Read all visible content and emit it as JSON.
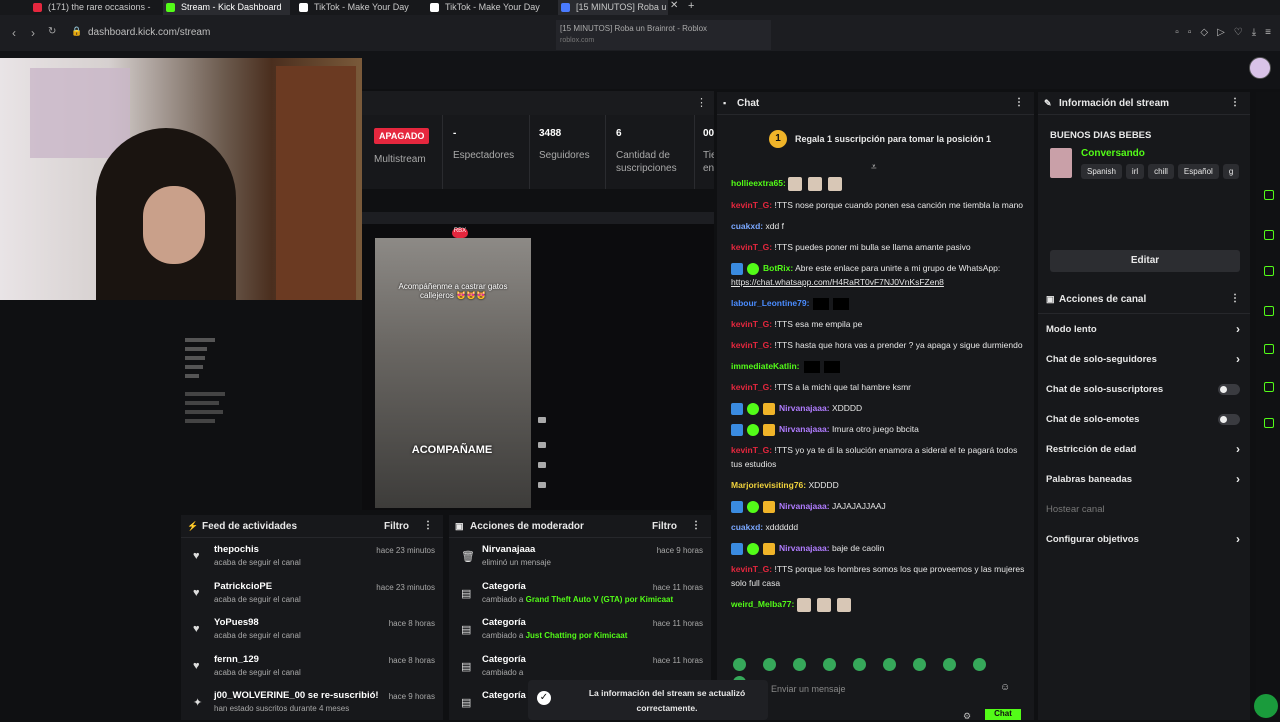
{
  "browser": {
    "tabs": [
      {
        "label": "(171) the rare occasions -",
        "color": "#e5273e"
      },
      {
        "label": "Stream - Kick Dashboard",
        "color": "#53fc18"
      },
      {
        "label": "TikTok - Make Your Day",
        "color": "#ffffff"
      },
      {
        "label": "TikTok - Make Your Day",
        "color": "#ffffff"
      },
      {
        "label": "[15 MINUTOS] Roba u",
        "color": "#4a7bff"
      }
    ],
    "url": "dashboard.kick.com/stream",
    "tooltip_title": "[15 MINUTOS] Roba un Brainrot - Roblox",
    "tooltip_domain": "roblox.com"
  },
  "stats": {
    "status": "APAGADO",
    "multistream": "Multistream",
    "viewers_value": "-",
    "viewers_label": "Espectadores",
    "followers_value": "3488",
    "followers_label": "Seguidores",
    "subs_value": "6",
    "subs_label": "Cantidad de suscripciones",
    "extra_value": "00",
    "extra_label": "Tie en"
  },
  "preview": {
    "caption_top": "Acompáñenme a castrar gatos callejeros 😻😻😻",
    "caption_bottom": "ACOMPAÑAME",
    "rbx": "RBX"
  },
  "activity": {
    "title": "Feed de actividades",
    "filter": "Filtro",
    "items": [
      {
        "name": "thepochis",
        "sub": "acaba de seguir el canal",
        "time": "hace 23 minutos"
      },
      {
        "name": "PatrickcioPE",
        "sub": "acaba de seguir el canal",
        "time": "hace 23 minutos"
      },
      {
        "name": "YoPues98",
        "sub": "acaba de seguir el canal",
        "time": "hace 8 horas"
      },
      {
        "name": "fernn_129",
        "sub": "acaba de seguir el canal",
        "time": "hace 8 horas"
      },
      {
        "name": "j00_WOLVERINE_00 se re-suscribió!",
        "sub": "han estado suscritos durante 4 meses",
        "time": "hace 9 horas"
      }
    ]
  },
  "moderator": {
    "title": "Acciones de moderador",
    "filter": "Filtro",
    "items": [
      {
        "name": "Nirvanajaaa",
        "sub": "eliminó un mensaje",
        "hl": "",
        "by": "",
        "time": "hace 9 horas"
      },
      {
        "name": "Categoría",
        "sub": "cambiado a",
        "hl": "Grand Theft Auto V (GTA)",
        "by": "por Kimicaat",
        "time": "hace 11 horas"
      },
      {
        "name": "Categoría",
        "sub": "cambiado a",
        "hl": "Just Chatting",
        "by": "por Kimicaat",
        "time": "hace 11 horas"
      },
      {
        "name": "Categoría",
        "sub": "cambiado a",
        "hl": "",
        "by": "",
        "time": "hace 11 horas"
      },
      {
        "name": "Categoría",
        "sub": "",
        "hl": "",
        "by": "",
        "time": "hace 11 horas"
      }
    ]
  },
  "chat": {
    "title": "Chat",
    "pinned_rank": "1",
    "pinned_text": "Regala 1 suscripción para tomar la posición 1",
    "messages": [
      {
        "user": "hollieextra65:",
        "color": "#53fc18",
        "text": ""
      },
      {
        "user": "kevinT_G:",
        "color": "#e5273e",
        "text": "!TTS nose porque cuando ponen esa canción me tiembla la mano"
      },
      {
        "user": "cuakxd:",
        "color": "#7aa7ff",
        "text": "xdd f"
      },
      {
        "user": "kevinT_G:",
        "color": "#e5273e",
        "text": "!TTS puedes poner mi bulla se llama amante pasivo"
      },
      {
        "user": "BotRix:",
        "color": "#53fc18",
        "text": "Abre este enlace para unirte a mi grupo de WhatsApp:",
        "link": "https://chat.whatsapp.com/H4RaRT0vF7NJ0VnKsFZen8"
      },
      {
        "user": "labour_Leontine79:",
        "color": "#4a8cff",
        "text": ""
      },
      {
        "user": "kevinT_G:",
        "color": "#e5273e",
        "text": "!TTS esa me empila pe"
      },
      {
        "user": "kevinT_G:",
        "color": "#e5273e",
        "text": "!TTS hasta que hora vas a prender ? ya apaga y sigue durmiendo"
      },
      {
        "user": "immediateKatlin:",
        "color": "#53fc18",
        "text": ""
      },
      {
        "user": "kevinT_G:",
        "color": "#e5273e",
        "text": "!TTS a la michi que tal hambre ksmr"
      },
      {
        "user": "Nirvanajaaa:",
        "color": "#b07cff",
        "text": "XDDDD"
      },
      {
        "user": "Nirvanajaaa:",
        "color": "#b07cff",
        "text": "Imura otro juego bbcita"
      },
      {
        "user": "kevinT_G:",
        "color": "#e5273e",
        "text": "!TTS yo ya te di la solución enamora a sideral el te pagará todos tus estudios"
      },
      {
        "user": "Marjorievisiting76:",
        "color": "#f0d23c",
        "text": "XDDDD"
      },
      {
        "user": "Nirvanajaaa:",
        "color": "#b07cff",
        "text": "JAJAJAJJAAJ"
      },
      {
        "user": "cuakxd:",
        "color": "#7aa7ff",
        "text": "xdddddd"
      },
      {
        "user": "Nirvanajaaa:",
        "color": "#b07cff",
        "text": "baje de caolin"
      },
      {
        "user": "kevinT_G:",
        "color": "#e5273e",
        "text": "!TTS porque los hombres somos los que proveemos y las mujeres solo full casa"
      },
      {
        "user": "weird_Melba77:",
        "color": "#53fc18",
        "text": ""
      }
    ],
    "placeholder": "Enviar un mensaje",
    "send": "Chat"
  },
  "info": {
    "title": "Información del stream",
    "stream_title": "BUENOS DIAS BEBES",
    "category": "Conversando",
    "tags": [
      "Spanish",
      "irl",
      "chill",
      "Español",
      "g"
    ],
    "edit": "Editar"
  },
  "actions": {
    "title": "Acciones de canal",
    "items": [
      {
        "label": "Modo lento",
        "kind": "chevron"
      },
      {
        "label": "Chat de solo-seguidores",
        "kind": "chevron"
      },
      {
        "label": "Chat de solo-suscriptores",
        "kind": "toggle"
      },
      {
        "label": "Chat de solo-emotes",
        "kind": "toggle"
      },
      {
        "label": "Restricción de edad",
        "kind": "chevron"
      },
      {
        "label": "Palabras baneadas",
        "kind": "chevron"
      },
      {
        "label": "Hostear canal",
        "kind": "dim"
      },
      {
        "label": "Configurar objetivos",
        "kind": "chevron"
      }
    ]
  },
  "toast": {
    "text": "La información del stream se actualizó correctamente."
  },
  "colors": {
    "accent": "#53fc18",
    "danger": "#e5273e",
    "panel": "#17181b"
  }
}
